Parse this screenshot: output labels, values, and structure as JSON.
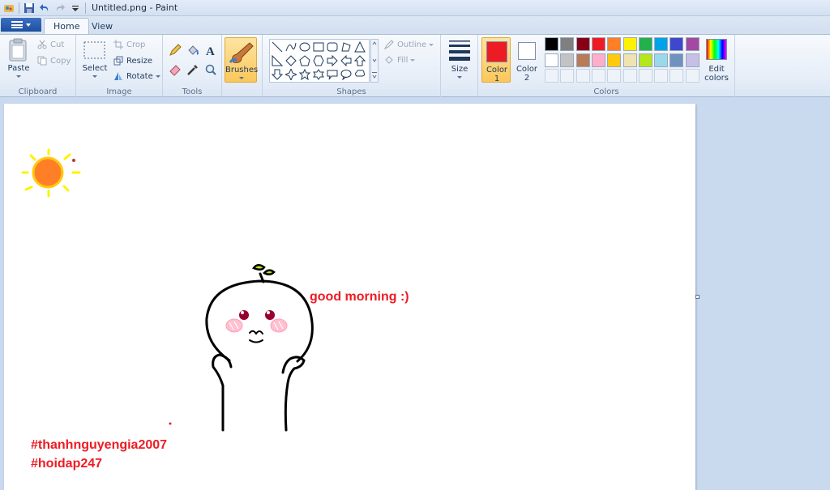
{
  "window": {
    "title": "Untitled.png - Paint"
  },
  "tabs": [
    {
      "label": "Home",
      "active": true
    },
    {
      "label": "View",
      "active": false
    }
  ],
  "clipboard": {
    "paste": "Paste",
    "cut": "Cut",
    "copy": "Copy",
    "group": "Clipboard"
  },
  "image": {
    "select": "Select",
    "crop": "Crop",
    "resize": "Resize",
    "rotate": "Rotate",
    "group": "Image"
  },
  "tools": {
    "group": "Tools"
  },
  "brushes": {
    "label": "Brushes"
  },
  "shapes": {
    "outline": "Outline",
    "fill": "Fill",
    "group": "Shapes"
  },
  "size": {
    "label": "Size"
  },
  "colors": {
    "color1_label": "Color",
    "color1_num": "1",
    "color2_label": "Color",
    "color2_num": "2",
    "edit": "Edit",
    "edit2": "colors",
    "group": "Colors",
    "color1": "#ed1c24",
    "color2": "#ffffff",
    "palette_row1": [
      "#000000",
      "#7f7f7f",
      "#880015",
      "#ed1c24",
      "#ff7f27",
      "#fff200",
      "#22b14c",
      "#00a2e8",
      "#3f48cc",
      "#a349a4"
    ],
    "palette_row2": [
      "#ffffff",
      "#c3c3c3",
      "#b97a57",
      "#ffaec9",
      "#ffc90e",
      "#efe4b0",
      "#b5e61d",
      "#99d9ea",
      "#7092be",
      "#c8bfe7"
    ]
  },
  "canvas": {
    "greeting": "good morning :)",
    "hashtag1": "#thanhnguyengia2007",
    "hashtag2": "#hoidap247"
  }
}
